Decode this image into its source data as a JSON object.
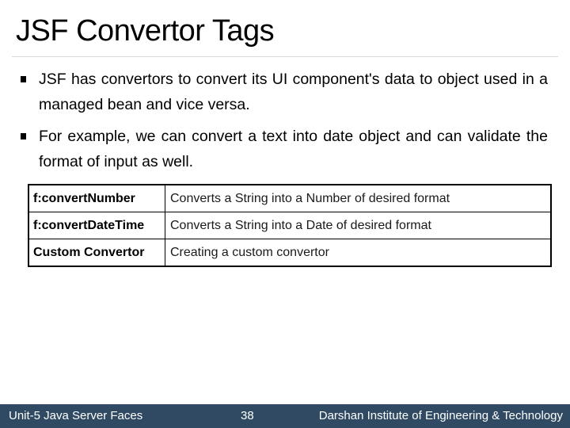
{
  "slide": {
    "title": "JSF Convertor Tags",
    "bullets": [
      {
        "icon": "square-bullet",
        "text": "JSF has convertors to convert its UI component's data to object used in a managed bean and vice versa."
      },
      {
        "icon": "square-bullet",
        "text": "For example, we can convert a text into date object and can validate the format of input as well."
      }
    ],
    "table": {
      "rows": [
        {
          "tag": "f:convertNumber",
          "description": "Converts a String into a Number of desired format"
        },
        {
          "tag": "f:convertDateTime",
          "description": "Converts a String into a Date of desired format"
        },
        {
          "tag": "Custom Convertor",
          "description": "Creating a custom convertor"
        }
      ]
    }
  },
  "footer": {
    "unit": "Unit-5 Java Server Faces",
    "page_number": "38",
    "institute": "Darshan Institute of Engineering & Technology",
    "background_color": "#2f4a62"
  }
}
